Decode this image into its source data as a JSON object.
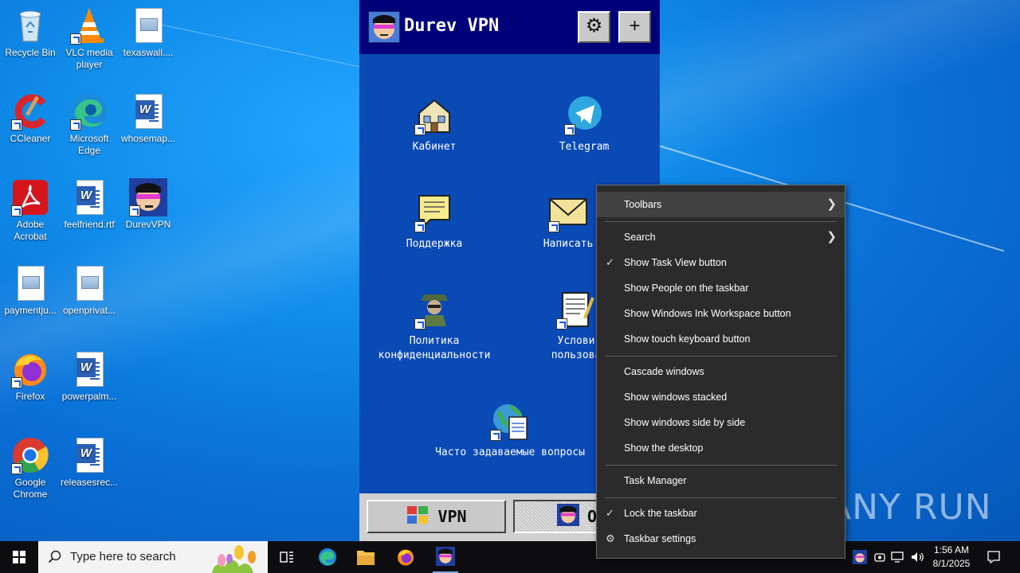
{
  "desktop": {
    "icons": [
      {
        "label": "Recycle Bin",
        "icon": "recycle-bin-icon"
      },
      {
        "label": "VLC media player",
        "icon": "vlc-icon"
      },
      {
        "label": "texaswall....",
        "icon": "image-file-icon"
      },
      {
        "label": "CCleaner",
        "icon": "ccleaner-icon"
      },
      {
        "label": "Microsoft Edge",
        "icon": "edge-icon"
      },
      {
        "label": "whosemap...",
        "icon": "word-doc-icon"
      },
      {
        "label": "Adobe Acrobat",
        "icon": "acrobat-icon"
      },
      {
        "label": "feelfriend.rtf",
        "icon": "word-doc-icon"
      },
      {
        "label": "DurevVPN",
        "icon": "durevvpn-icon"
      },
      {
        "label": "paymentju...",
        "icon": "image-file-icon"
      },
      {
        "label": "openprivat...",
        "icon": "image-file-icon"
      },
      {
        "label": "Firefox",
        "icon": "firefox-icon"
      },
      {
        "label": "powerpalm...",
        "icon": "word-doc-icon"
      },
      {
        "label": "Google Chrome",
        "icon": "chrome-icon"
      },
      {
        "label": "releasesrec...",
        "icon": "word-doc-icon"
      }
    ]
  },
  "vpn_app": {
    "title": "Durev VPN",
    "settings_icon": "gear-icon",
    "add_label": "+",
    "items": [
      {
        "label": "Кабинет",
        "icon": "house-icon"
      },
      {
        "label": "Telegram",
        "icon": "telegram-icon"
      },
      {
        "label": "Поддержка",
        "icon": "note-icon"
      },
      {
        "label": "Написать",
        "icon": "envelope-icon"
      },
      {
        "label_line1": "Политика",
        "label_line2": "конфиденциальности",
        "icon": "agent-icon"
      },
      {
        "label_line1": "Услови",
        "label_line2": "пользова",
        "icon": "notepad-icon"
      },
      {
        "label": "Часто задаваемые вопросы",
        "icon": "globe-doc-icon"
      }
    ],
    "bottom": {
      "vpn_label": "VPN",
      "about_label": "О н"
    }
  },
  "context_menu": {
    "items": [
      {
        "label": "Toolbars",
        "submenu": true,
        "checked": false
      },
      {
        "label": "Search",
        "submenu": true,
        "checked": false
      },
      {
        "label": "Show Task View button",
        "checked": true
      },
      {
        "label": "Show People on the taskbar",
        "checked": false
      },
      {
        "label": "Show Windows Ink Workspace button",
        "checked": false
      },
      {
        "label": "Show touch keyboard button",
        "checked": false
      },
      {
        "label": "Cascade windows",
        "checked": false
      },
      {
        "label": "Show windows stacked",
        "checked": false
      },
      {
        "label": "Show windows side by side",
        "checked": false
      },
      {
        "label": "Show the desktop",
        "checked": false
      },
      {
        "label": "Task Manager",
        "checked": false
      },
      {
        "label": "Lock the taskbar",
        "checked": true
      },
      {
        "label": "Taskbar settings",
        "icon": "gear-icon"
      }
    ]
  },
  "watermark": "ANY RUN",
  "taskbar": {
    "search_placeholder": "Type here to search",
    "time": "1:56 AM",
    "date": "8/1/2025"
  },
  "colors": {
    "vpn_header": "#00007a",
    "vpn_body": "#0a4ab5",
    "menu_bg": "#2b2b2b",
    "taskbar_bg": "#0d0d10"
  }
}
